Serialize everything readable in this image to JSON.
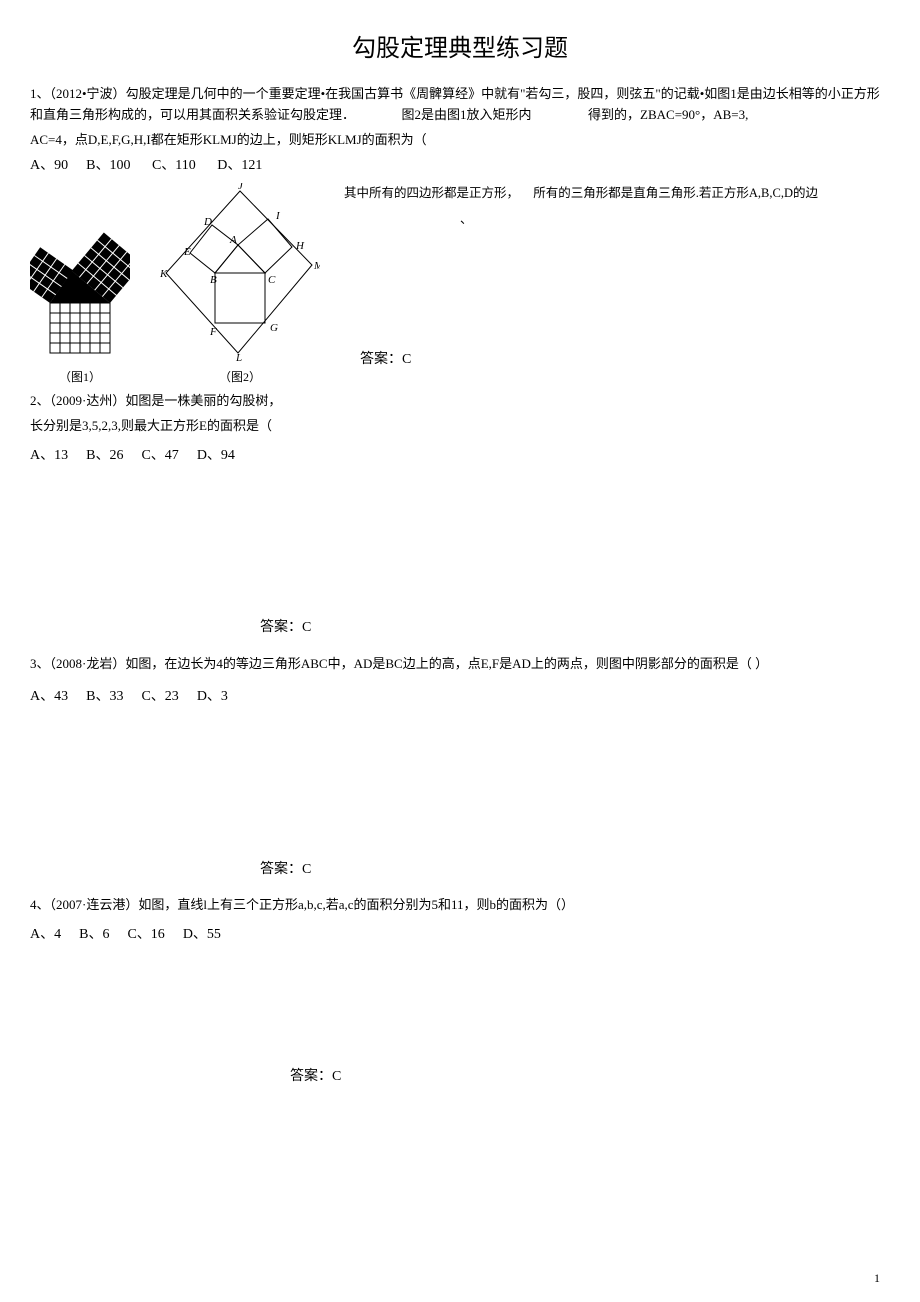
{
  "title": "勾股定理典型练习题",
  "q1": {
    "num": "1、（2012•宁波）",
    "text_a": "勾股定理是几何中的一个重要定理•在我国古算书《周髀算经》中就有\"若勾三，股四，则弦五\"的记载•如图1是由边长相等的小正方形和直角三角形构成的，可以用其面积关系验证勾股定理．",
    "text_b": "图2是由图1放入矩形内",
    "text_c": "得到的，ZBAC=90°，AB=3,",
    "text_d": "AC=4，点D,E,F,G,H,I都在矩形KLMJ的边上，则矩形KLMJ的面积为（",
    "optA": "A、90",
    "optB": "B、100",
    "optC": "C、110",
    "optD": "D、121",
    "inline_text_l": "其中所有的四边形都是正方形，",
    "inline_text_r": "所有的三角形都是直角三角形.若正方形A,B,C,D的边",
    "inline_text_2": "、",
    "fig1_label": "（图1）",
    "fig2_label": "（图2）",
    "answer": "答案：C"
  },
  "q2": {
    "num": "2、（2009·达州）",
    "text_a": "如图是一株美丽的勾股树，",
    "text_b": "长分别是3,5,2,3,则最大正方形E的面积是（",
    "optA": "A、13",
    "optB": "B、26",
    "optC": "C、47",
    "optD": "D、94",
    "answer": "答案：C"
  },
  "q3": {
    "num": "3、（2008·龙岩）",
    "text": "如图，在边长为4的等边三角形ABC中，AD是BC边上的高，点E,F是AD上的两点，则图中阴影部分的面积是（ ）",
    "optA": "A、43",
    "optB": "B、33",
    "optC": "C、23",
    "optD": "D、3",
    "answer": "答案：C"
  },
  "q4": {
    "num": "4、（2007·连云港）",
    "text": "如图，直线l上有三个正方形a,b,c,若a,c的面积分别为5和11，则b的面积为（）",
    "optA": "A、4",
    "optB": "B、6",
    "optC": "C、16",
    "optD": "D、55",
    "answer": "答案：C"
  },
  "page_number": "1"
}
